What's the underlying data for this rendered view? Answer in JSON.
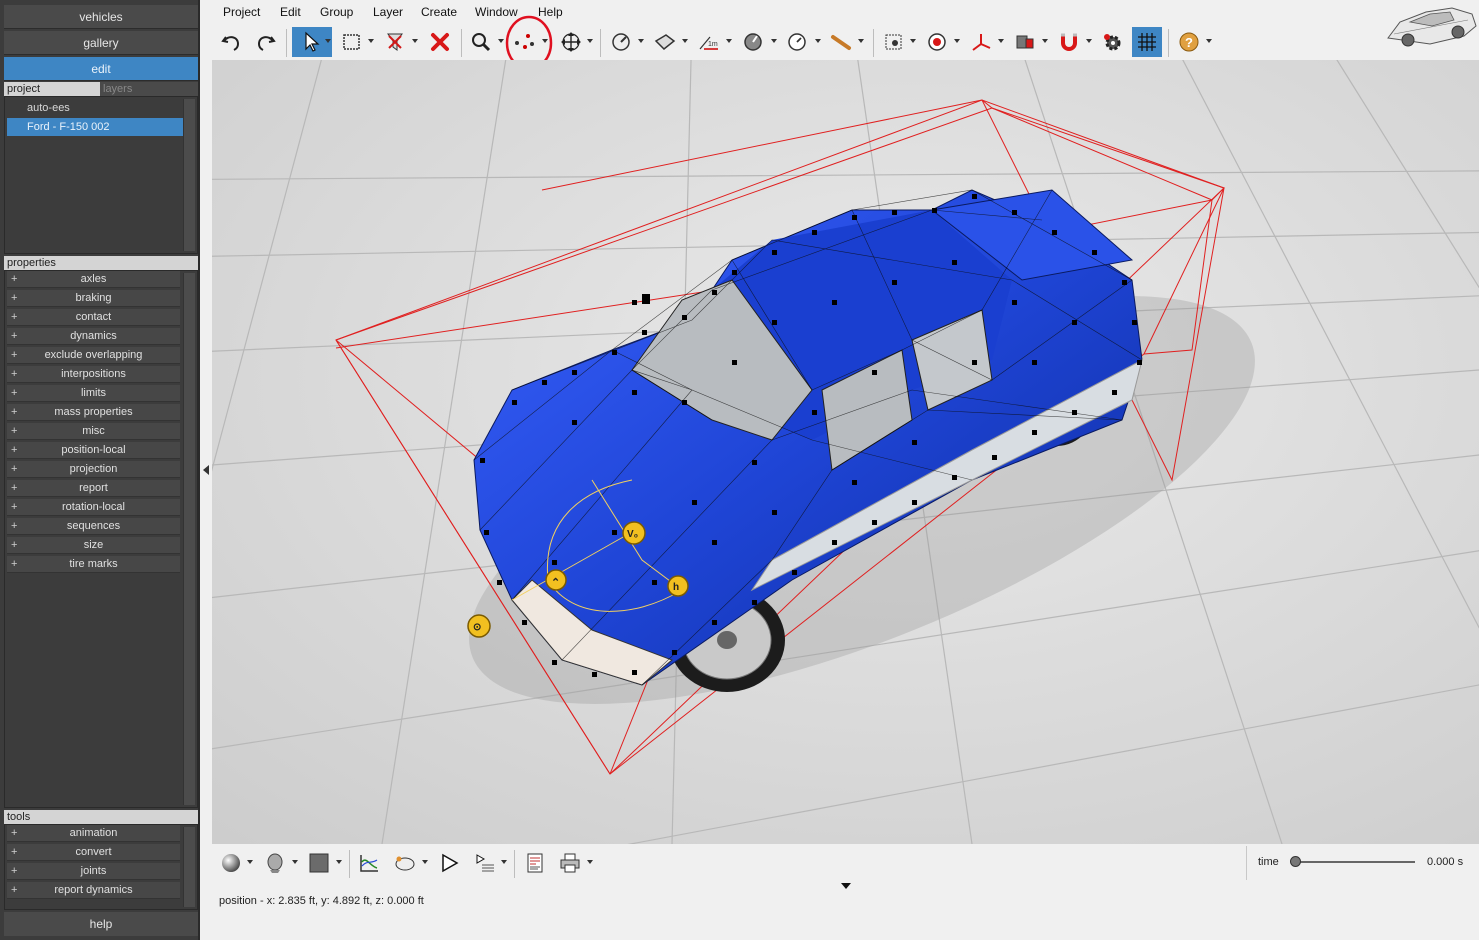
{
  "nav": {
    "vehicles": "vehicles",
    "gallery": "gallery",
    "edit": "edit",
    "help": "help"
  },
  "project": {
    "header": "project",
    "tab_layers": "layers",
    "items": [
      "auto-ees",
      "Ford - F-150 002"
    ]
  },
  "properties": {
    "header": "properties",
    "items": [
      "axles",
      "braking",
      "contact",
      "dynamics",
      "exclude overlapping",
      "interpositions",
      "limits",
      "mass properties",
      "misc",
      "position-local",
      "projection",
      "report",
      "rotation-local",
      "sequences",
      "size",
      "tire marks"
    ]
  },
  "tools": {
    "header": "tools",
    "items": [
      "animation",
      "convert",
      "joints",
      "report dynamics"
    ]
  },
  "menu": [
    "Project",
    "Edit",
    "Group",
    "Layer",
    "Create",
    "Window",
    "Help"
  ],
  "time": {
    "label": "time",
    "value": "0.000 s",
    "slider_fraction": 0
  },
  "status": {
    "position": "position - x: 2.835 ft, y: 4.892 ft, z: 0.000 ft"
  },
  "viewport": {
    "marker_labels": [
      "V₀",
      "⌃",
      "h",
      "⊙"
    ]
  },
  "colors": {
    "accent": "#3e86c4",
    "truck_blue": "#1f45d6",
    "bounding_box": "#e02020",
    "highlight_circle": "#e01020",
    "marker_yellow": "#f2c020"
  }
}
